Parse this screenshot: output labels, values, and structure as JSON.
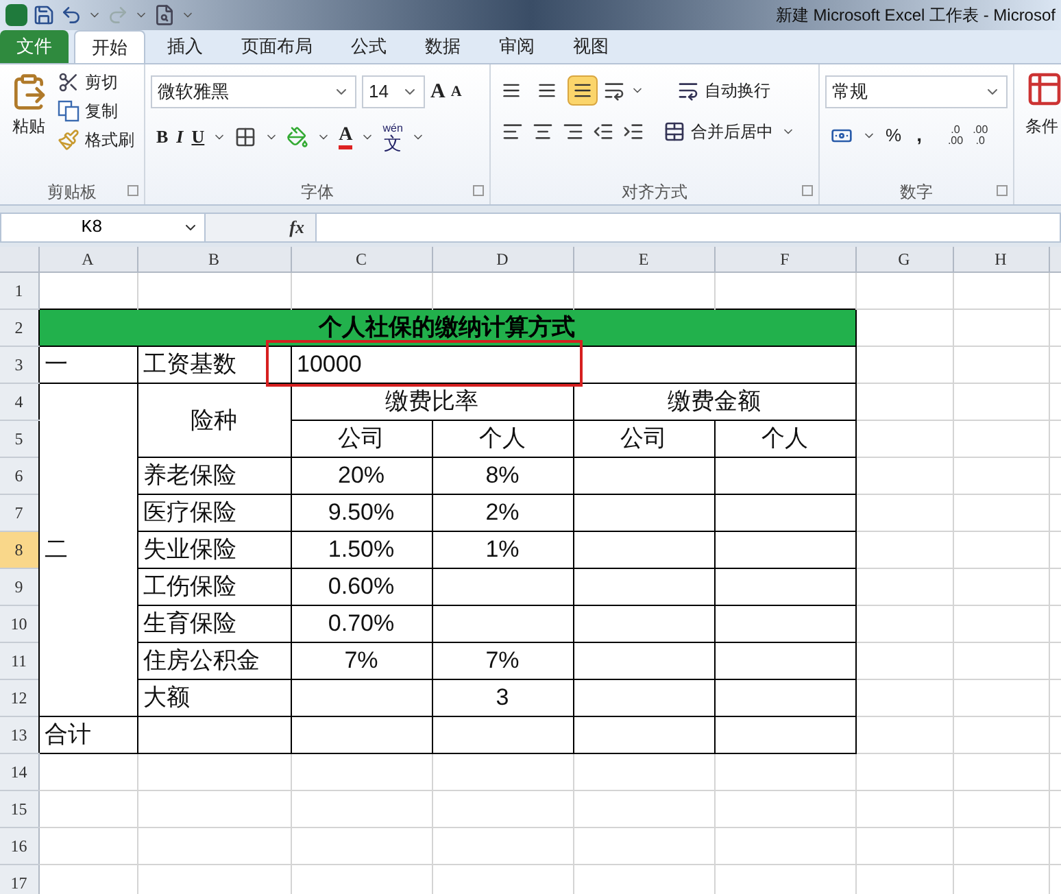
{
  "window": {
    "title": "新建 Microsoft Excel 工作表 - Microsof"
  },
  "ribbon_tabs": [
    {
      "label": "文件",
      "kind": "file",
      "selected": false
    },
    {
      "label": "开始",
      "kind": "tab",
      "selected": true
    },
    {
      "label": "插入",
      "kind": "tab",
      "selected": false
    },
    {
      "label": "页面布局",
      "kind": "tab",
      "selected": false
    },
    {
      "label": "公式",
      "kind": "tab",
      "selected": false
    },
    {
      "label": "数据",
      "kind": "tab",
      "selected": false
    },
    {
      "label": "审阅",
      "kind": "tab",
      "selected": false
    },
    {
      "label": "视图",
      "kind": "tab",
      "selected": false
    }
  ],
  "clipboard": {
    "paste": "粘贴",
    "cut": "剪切",
    "copy": "复制",
    "format_painter": "格式刷",
    "group_label": "剪贴板"
  },
  "font": {
    "name": "微软雅黑",
    "size": "14",
    "grow": "A",
    "shrink": "A",
    "bold": "B",
    "italic": "I",
    "underline": "U",
    "font_color": "A",
    "phonetic_top": "wén",
    "phonetic_bottom": "文",
    "group_label": "字体"
  },
  "alignment": {
    "vertical": [
      {
        "selected": false
      },
      {
        "selected": false
      },
      {
        "selected": true
      }
    ],
    "wrap_text": "自动换行",
    "merge_center": "合并后居中",
    "group_label": "对齐方式"
  },
  "number": {
    "format": "常规",
    "percent": "%",
    "comma": ",",
    "increase_decimal": [
      ".0",
      ".00"
    ],
    "decrease_decimal": [
      ".00",
      ".0"
    ],
    "group_label": "数字"
  },
  "styles": {
    "conditional_format": "条件"
  },
  "formula_bar": {
    "name_box": "K8",
    "fx": "fx"
  },
  "sheet": {
    "columns": [
      "A",
      "B",
      "C",
      "D",
      "E",
      "F",
      "G",
      "H"
    ],
    "rows": [
      {
        "label": "1",
        "selected": false
      },
      {
        "label": "2",
        "selected": false
      },
      {
        "label": "3",
        "selected": false
      },
      {
        "label": "4",
        "selected": false
      },
      {
        "label": "5",
        "selected": false
      },
      {
        "label": "6",
        "selected": false
      },
      {
        "label": "7",
        "selected": false
      },
      {
        "label": "8",
        "selected": true
      },
      {
        "label": "9",
        "selected": false
      },
      {
        "label": "10",
        "selected": false
      },
      {
        "label": "11",
        "selected": false
      },
      {
        "label": "12",
        "selected": false
      },
      {
        "label": "13",
        "selected": false
      },
      {
        "label": "14",
        "selected": false
      },
      {
        "label": "15",
        "selected": false
      },
      {
        "label": "16",
        "selected": false
      },
      {
        "label": "17",
        "selected": false
      }
    ],
    "title": "个人社保的缴纳计算方式",
    "section_1": "一",
    "salary_label": "工资基数",
    "salary_value": "10000",
    "section_2": "二",
    "type_header": "险种",
    "rate_header": "缴费比率",
    "amount_header": "缴费金额",
    "sub_headers": [
      "公司",
      "个人",
      "公司",
      "个人"
    ],
    "items": [
      {
        "name": "养老保险",
        "company_rate": "20%",
        "personal_rate": "8%"
      },
      {
        "name": "医疗保险",
        "company_rate": "9.50%",
        "personal_rate": "2%"
      },
      {
        "name": "失业保险",
        "company_rate": "1.50%",
        "personal_rate": "1%"
      },
      {
        "name": "工伤保险",
        "company_rate": "0.60%"
      },
      {
        "name": "生育保险",
        "company_rate": "0.70%"
      },
      {
        "name": "住房公积金",
        "company_rate": "7%",
        "personal_rate": "7%"
      },
      {
        "name": "大额",
        "personal_rate": "3"
      }
    ],
    "total_label": "合计",
    "annotation_box": true
  }
}
